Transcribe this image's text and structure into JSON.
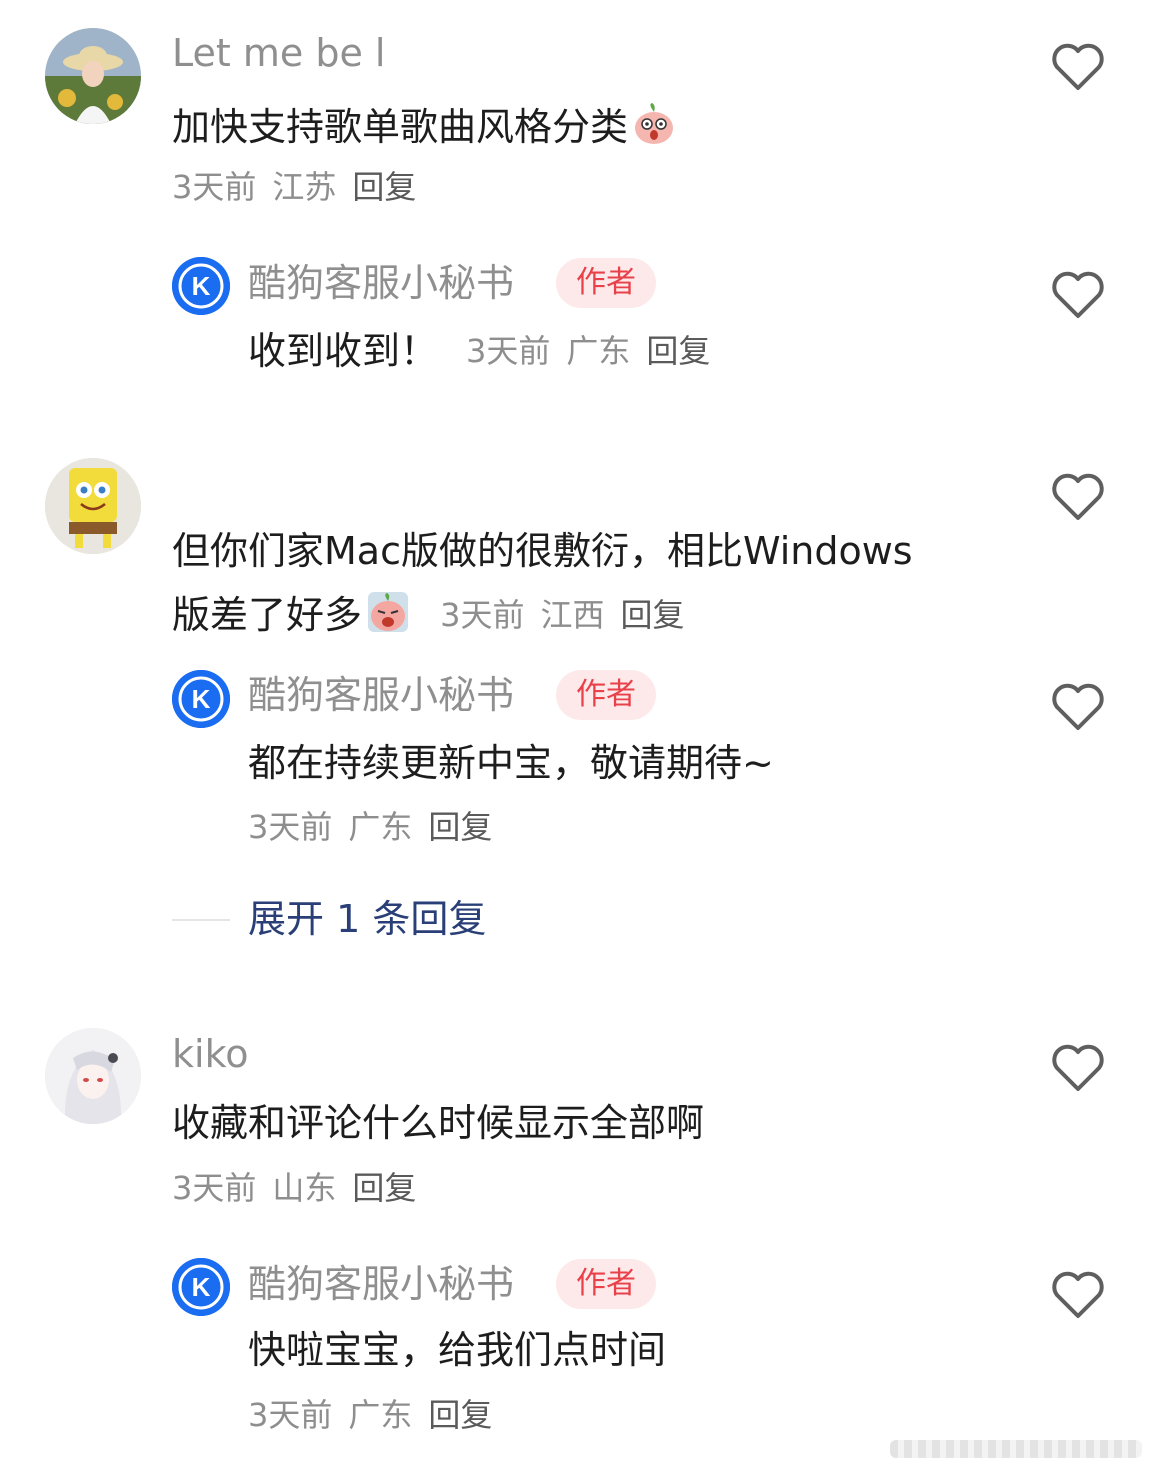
{
  "comments": [
    {
      "username": "Let me be l",
      "text": "加快支持歌单歌曲风格分类",
      "emoji": "shocked-peach-emoji",
      "time": "3天前",
      "location": "江苏",
      "reply_label": "回复",
      "replies": [
        {
          "username": "酷狗客服小秘书",
          "badge": "作者",
          "text": "收到收到！",
          "time": "3天前",
          "location": "广东",
          "reply_label": "回复"
        }
      ]
    },
    {
      "username": "",
      "text_line1": "但你们家Mac版做的很敷衍，相比Windows",
      "text_line2": "版差了好多",
      "emoji": "crying-peach-emoji",
      "time": "3天前",
      "location": "江西",
      "reply_label": "回复",
      "replies": [
        {
          "username": "酷狗客服小秘书",
          "badge": "作者",
          "text": "都在持续更新中宝，敬请期待~",
          "time": "3天前",
          "location": "广东",
          "reply_label": "回复"
        }
      ],
      "expand_label": "展开 1 条回复"
    },
    {
      "username": "kiko",
      "text": "收藏和评论什么时候显示全部啊",
      "time": "3天前",
      "location": "山东",
      "reply_label": "回复",
      "replies": [
        {
          "username": "酷狗客服小秘书",
          "badge": "作者",
          "text": "快啦宝宝，给我们点时间",
          "time": "3天前",
          "location": "广东",
          "reply_label": "回复"
        }
      ]
    }
  ],
  "colors": {
    "username": "#8f8f8f",
    "text": "#1d1d1d",
    "meta": "#8e8e8e",
    "badge_bg": "#fde9ea",
    "badge_text": "#e8414a",
    "kugou_blue": "#1a6cf0",
    "expand_link": "#2a3f78"
  }
}
